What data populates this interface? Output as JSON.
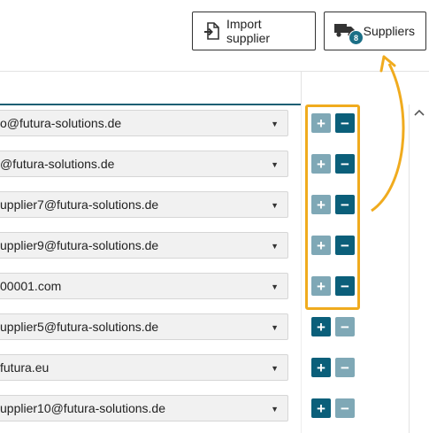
{
  "toolbar": {
    "import_label": "Import supplier",
    "import_icon": "import-file-icon",
    "suppliers_label": "Suppliers",
    "suppliers_icon": "truck-icon",
    "suppliers_count": "8"
  },
  "rows": [
    {
      "value": "o@futura-solutions.de",
      "plus": "enabled",
      "minus": "enabled"
    },
    {
      "value": "@futura-solutions.de",
      "plus": "enabled",
      "minus": "enabled"
    },
    {
      "value": "upplier7@futura-solutions.de",
      "plus": "enabled",
      "minus": "enabled"
    },
    {
      "value": "upplier9@futura-solutions.de",
      "plus": "enabled",
      "minus": "enabled"
    },
    {
      "value": "00001.com",
      "plus": "enabled",
      "minus": "enabled"
    },
    {
      "value": "upplier5@futura-solutions.de",
      "plus": "enabled",
      "minus": "disabled"
    },
    {
      "value": "futura.eu",
      "plus": "enabled",
      "minus": "disabled"
    },
    {
      "value": "upplier10@futura-solutions.de",
      "plus": "enabled",
      "minus": "disabled"
    }
  ],
  "row_buttons": {
    "plus": "+",
    "minus": "−"
  },
  "colors": {
    "accent": "#0b5f7a",
    "button_light": "#7fa8b6",
    "highlight": "#f0ab1e",
    "header_line": "#1b5f73"
  }
}
